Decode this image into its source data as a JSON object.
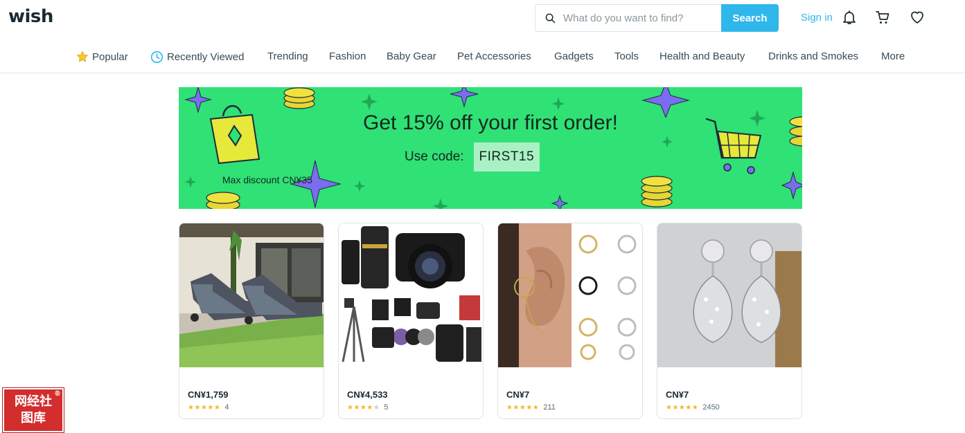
{
  "header": {
    "logo": "wish",
    "search_placeholder": "What do you want to find?",
    "search_button": "Search",
    "sign_in": "Sign in"
  },
  "categories": [
    {
      "label": "Popular",
      "icon": "star-icon"
    },
    {
      "label": "Recently Viewed",
      "icon": "clock-icon"
    },
    {
      "label": "Trending"
    },
    {
      "label": "Fashion"
    },
    {
      "label": "Baby Gear"
    },
    {
      "label": "Pet Accessories"
    },
    {
      "label": "Gadgets"
    },
    {
      "label": "Tools"
    },
    {
      "label": "Health and Beauty"
    },
    {
      "label": "Drinks and Smokes"
    },
    {
      "label": "More"
    }
  ],
  "banner": {
    "title": "Get 15% off your first order!",
    "code_label": "Use code:",
    "code": "FIRST15",
    "max_discount": "Max discount CN¥35"
  },
  "products": [
    {
      "price": "CN¥1,759",
      "rating": 5,
      "reviews": "4",
      "image": "patio-lounge-chairs"
    },
    {
      "price": "CN¥4,533",
      "rating": 4,
      "reviews": "5",
      "image": "canon-camera-kit"
    },
    {
      "price": "CN¥7",
      "rating": 4.5,
      "reviews": "211",
      "image": "chain-ear-cuffs"
    },
    {
      "price": "CN¥7",
      "rating": 4.5,
      "reviews": "2450",
      "image": "crystal-drop-earrings"
    }
  ],
  "watermark": {
    "line1": "网经社",
    "line2": "图库",
    "mark": "®"
  },
  "colors": {
    "accent": "#2fb7ec",
    "banner": "#30e176",
    "code_chip": "#a9f1c5",
    "star": "#f7b52c"
  }
}
